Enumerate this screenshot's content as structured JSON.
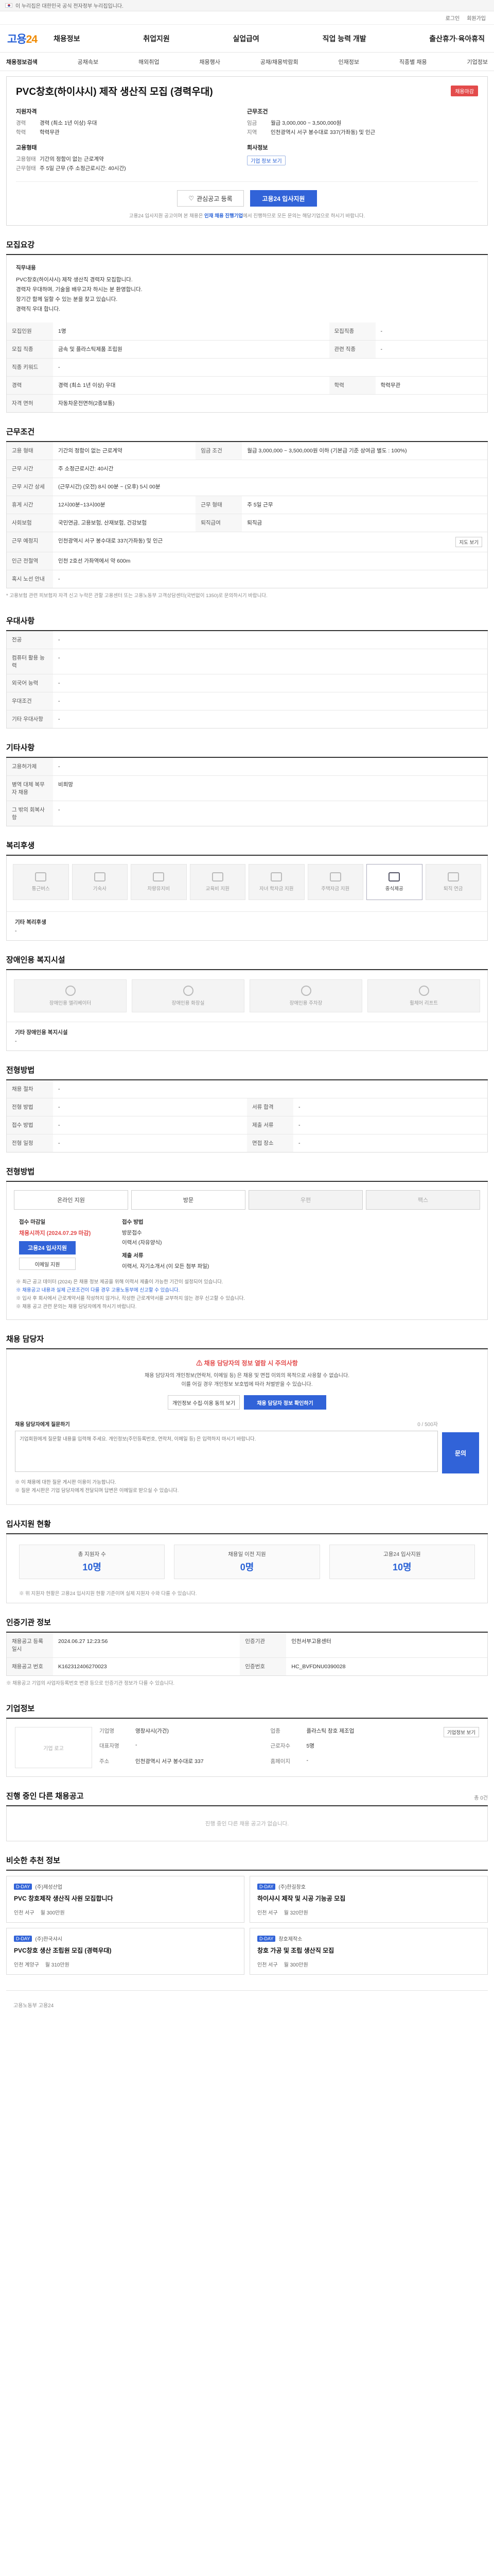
{
  "topbar": {
    "notice": "이 누리집은 대한민국 공식 전자정부 누리집입니다."
  },
  "util": [
    "로그인",
    "회원가입"
  ],
  "header": {
    "logo_main": "고용",
    "logo_sub": "24",
    "menu": [
      "채용정보",
      "취업지원",
      "실업급여",
      "직업 능력 개발",
      "출산휴가·육아휴직"
    ]
  },
  "subnav": [
    "채용정보검색",
    "공채속보",
    "해외취업",
    "채용행사",
    "공채/채용박람회",
    "인재정보",
    "직종별 채용",
    "기업정보"
  ],
  "job": {
    "title": "PVC창호(하이샤시) 제작 생산직 모집 (경력우대)",
    "badge": "채용마감",
    "left_title": "지원자격",
    "left": [
      {
        "k": "경력",
        "v": "경력 (최소 1년 이상) 우대"
      },
      {
        "k": "학력",
        "v": "학력무관"
      }
    ],
    "left_title2": "고용형태",
    "left2": [
      {
        "k": "고용형태",
        "v": "기간의 정함이 없는 근로계약"
      },
      {
        "k": "근무형태",
        "v": "주 5일 근무 (주 소정근로시간: 40시간)"
      }
    ],
    "right_title": "근무조건",
    "right": [
      {
        "k": "임금",
        "v": "월급 3,000,000 ~ 3,500,000원"
      },
      {
        "k": "지역",
        "v": "인천광역시 서구 봉수대로 337(가좌동) 및 인근"
      }
    ],
    "right_title2": "회사정보",
    "company_tag": "기업 정보 보기",
    "scrap_label": "관심공고 등록",
    "apply_label": "고용24 입사지원",
    "note_prefix": "고용24 입사지원 공고이며 본 채용은 ",
    "note_strong": "인재 채용 진행기업",
    "note_suffix": "에서 진행하므로 모든 문의는 해당기업으로 하시기 바랍니다."
  },
  "sections": {
    "summary": "모집요강",
    "conditions": "근무조건",
    "welfare_title": "우대사항",
    "etc": "기타사항",
    "benefits": "복리후생",
    "disabled": "장애인용 복지시설",
    "process": "전형방법",
    "apply": "전형방법",
    "contact": "채용 담당자",
    "stats": "입사지원 현황",
    "status": "인증기관 정보",
    "company": "기업정보",
    "others": "진행 중인 다른 채용공고",
    "similar": "비슷한 추천 정보"
  },
  "summary": {
    "head": "직무내용",
    "lines": [
      "PVC창호(하이샤시) 제작 생산직 경력자 모집합니다.",
      "경력자 우대하며, 기술을 배우고자 하시는 분 환영합니다.",
      "장기간 함께 일할 수 있는 분을 찾고 있습니다.",
      "경력직 우대 합니다."
    ],
    "rows": [
      {
        "k": "모집인원",
        "v": "1명",
        "k2": "모집직종",
        "v2": "-"
      },
      {
        "k": "모집 직종",
        "v": "금속 및 플라스틱제품 조립원",
        "k2": "관련 직종",
        "v2": "-"
      },
      {
        "k": "직종 키워드",
        "v": "-",
        "k2": "",
        "v2": ""
      },
      {
        "k": "경력",
        "v": "경력 (최소 1년 이상) 우대",
        "k2": "학력",
        "v2": "학력무관"
      },
      {
        "k": "자격 면허",
        "v": "자동차운전면허(2종보통)",
        "k2": "",
        "v2": ""
      }
    ]
  },
  "conditions": {
    "rows": [
      {
        "k": "고용 형태",
        "v": "기간의 정함이 없는 근로계약",
        "k2": "임금 조건",
        "v2": "월급 3,000,000 ~ 3,500,000원 이하 (기본급 기준 상여금 별도 : 100%)"
      },
      {
        "k": "근무 시간",
        "v": "주 소정근로시간: 40시간",
        "k2": "",
        "v2": ""
      },
      {
        "k": "근무 시간 상세",
        "v": "(근무시간) (오전) 8시 00분 ~ (오후) 5시 00분",
        "k2": "",
        "v2": ""
      },
      {
        "k": "휴게 시간",
        "v": "12시00분~13시00분",
        "k2": "근무 형태",
        "v2": "주 5일 근무"
      },
      {
        "k": "사회보험",
        "v": "국민연금, 고용보험, 산재보험, 건강보험",
        "k2": "퇴직급여",
        "v2": "퇴직금"
      },
      {
        "k": "근무 예정지",
        "v": "인천광역시 서구 봉수대로 337(가좌동) 및 인근",
        "k2": "",
        "v2": ""
      },
      {
        "k": "인근 전철역",
        "v": "인천 2호선 가좌역에서 약 600m",
        "k2": "",
        "v2": ""
      },
      {
        "k": "혹시 노선 안내",
        "v": "-",
        "k2": "",
        "v2": ""
      }
    ],
    "map_label": "지도 보기",
    "note": "* 고용보험 관련 피보험자 자격 신고 누락은 관할 고용센터 또는 고용노동부 고객상담센터(국번없이 1350)로 문의하시기 바랍니다."
  },
  "preference": {
    "rows": [
      {
        "k": "전공",
        "v": "-"
      },
      {
        "k": "컴퓨터 활용 능력",
        "v": "-"
      },
      {
        "k": "외국어 능력",
        "v": "-"
      },
      {
        "k": "우대조건",
        "v": "-"
      },
      {
        "k": "기타 우대사항",
        "v": "-"
      }
    ]
  },
  "etc": {
    "rows": [
      {
        "k": "고용허가제",
        "v": "-"
      },
      {
        "k": "병역 대체 복무자 채용",
        "v": "비희망"
      },
      {
        "k": "그 밖의 회복사항",
        "v": "-"
      }
    ]
  },
  "benefits": {
    "items": [
      {
        "label": "통근버스",
        "on": false
      },
      {
        "label": "기숙사",
        "on": false
      },
      {
        "label": "차량유지비",
        "on": false
      },
      {
        "label": "교육비 지원",
        "on": false
      },
      {
        "label": "자녀 학자금 지원",
        "on": false
      },
      {
        "label": "주택자금 지원",
        "on": false
      },
      {
        "label": "중식제공",
        "on": true
      },
      {
        "label": "퇴직 연금",
        "on": false
      }
    ],
    "detail_head": "기타 복리후생",
    "detail": "-"
  },
  "disabled": {
    "items": [
      "장애인용 엘리베이터",
      "장애인용 화장실",
      "장애인용 주차장",
      "휠체어 리프트"
    ],
    "detail_head": "기타 장애인용 복지시설",
    "detail": "-"
  },
  "process": {
    "rows": [
      {
        "k": "채용 절차",
        "v": "-",
        "k2": "",
        "v2": ""
      },
      {
        "k": "전형 방법",
        "v": "-",
        "k2": "서류 합격",
        "v2": "-"
      },
      {
        "k": "접수 방법",
        "v": "-",
        "k2": "제출 서류",
        "v2": "-"
      },
      {
        "k": "전형 일정",
        "v": "-",
        "k2": "면접 장소",
        "v2": "-"
      }
    ]
  },
  "apply": {
    "steps": [
      {
        "label": "온라인 지원",
        "off": false
      },
      {
        "label": "방문",
        "off": false
      },
      {
        "label": "우편",
        "off": true
      },
      {
        "label": "팩스",
        "off": true
      }
    ],
    "period_lbl": "접수 마감일",
    "period": "채용시까지 (2024.07.29 마감)",
    "apply_btn": "고용24 입사지원",
    "ext_btn": "이메일 지원",
    "method_lbl": "접수 방법",
    "method": "방문접수",
    "docs": "이력서 (자유양식)",
    "docs_lbl": "제출 서류",
    "docs2": "이력서, 자기소개서 (이 모든 첨부 파일)",
    "notes": [
      "※ 최근 공고 데이터 (2024) 은 채용 정보 제공을 위해 이력서 제출이 가능한 기간이 설정되어 있습니다.",
      "※ 채용공고 내용과 실제 근로조건이 다를 경우 고용노동부에 신고할 수 있습니다.",
      "※ 입사 후 회사에서 근로계약서를 작성하지 않거나, 작성한 근로계약서를 교부하지 않는 경우 신고할 수 있습니다.",
      "※ 채용 공고 관련 문의는 채용 담당자에게 하시기 바랍니다."
    ]
  },
  "contact": {
    "warn": "채용 담당자의 정보 열람 시 주의사항",
    "text1": "채용 담당자의 개인정보(연락처, 이메일 등) 은 채용 및 면접 이외의 목적으로 사용할 수 없습니다.",
    "text2": "이를 어길 경우 개인정보 보호법에 따라 처벌받을 수 있습니다.",
    "btn_view": "개인정보 수집·이용 동의 보기",
    "btn_check": "채용 담당자 정보 확인하기",
    "qa_title": "채용 담당자에게 질문하기",
    "qa_count": "0 / 500자",
    "qa_placeholder": "기업회원에게 질문할 내용을 입력해 주세요. 개인정보(주민등록번호, 연락처, 이메일 등) 은 입력하지 마시기 바랍니다.",
    "qa_submit": "문의",
    "qa_notes": [
      "※ 이 채용에 대한 질문 게시판 이용이 가능합니다.",
      "※ 질문 게시판은 기업 담당자에게 전달되며 답변은 이메일로 받으실 수 있습니다."
    ]
  },
  "stats": {
    "items": [
      {
        "t": "총 지원자 수",
        "n": "10명"
      },
      {
        "t": "채용일 이전 지원",
        "n": "0명"
      },
      {
        "t": "고용24 입사지원",
        "n": "10명"
      }
    ],
    "note": "※ 위 지원자 현황은 고용24 입사지원 현황 기준이며 실제 지원자 수와 다를 수 있습니다."
  },
  "status": {
    "rows": [
      {
        "k": "채용공고 등록일시",
        "v": "2024.06.27 12:23:56",
        "k2": "인증기관",
        "v2": "인천서부고용센터"
      },
      {
        "k": "채용공고 번호",
        "v": "K162312406270023",
        "k2": "인증번호",
        "v2": "HC_BVFDNU0390028"
      }
    ],
    "note": "※ 채용공고 기업의 사업자등록번호 변경 등으로 인증기관 정보가 다를 수 있습니다."
  },
  "company": {
    "logo": "기업 로고",
    "rows": [
      {
        "k": "기업명",
        "v": "영창샤시(가건)"
      },
      {
        "k": "업종",
        "v": "플라스틱 창호 제조업"
      },
      {
        "k": "대표자명",
        "v": "-"
      },
      {
        "k": "근로자수",
        "v": "5명"
      },
      {
        "k": "주소",
        "v": "인천광역시 서구 봉수대로 337"
      },
      {
        "k": "홈페이지",
        "v": "-"
      }
    ],
    "more_btn": "기업정보 보기"
  },
  "others": {
    "side": "총 0건",
    "empty": "진행 중인 다른 채용 공고가 없습니다."
  },
  "similar": {
    "cards": [
      {
        "co": "(주)제성산업",
        "title": "PVC 창호제작 생산직 사원 모집합니다",
        "loc": "인천 서구",
        "pay": "월 300만원"
      },
      {
        "co": "(주)한길창호",
        "title": "하이샤시 제작 및 시공 기능공 모집",
        "loc": "인천 서구",
        "pay": "월 320만원"
      },
      {
        "co": "(주)한국샤시",
        "title": "PVC창호 생산 조립원 모집 (경력우대)",
        "loc": "인천 계양구",
        "pay": "월 310만원"
      },
      {
        "co": "창호제작소",
        "title": "창호 가공 및 조립 생산직 모집",
        "loc": "인천 서구",
        "pay": "월 300만원"
      }
    ],
    "dday": "D-DAY"
  },
  "footer": {
    "text": "고용노동부 고용24"
  }
}
